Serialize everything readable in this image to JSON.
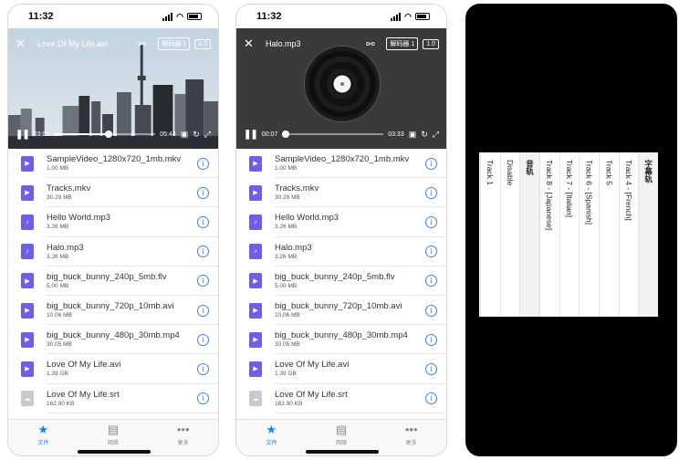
{
  "status": {
    "time": "11:32"
  },
  "screen1": {
    "player": {
      "title": "Love Of My Life.avi",
      "decoder_label": "解码器 1",
      "speed_label": "1.0",
      "current_time": "03:05",
      "total_time": "05:44",
      "progress": 0.54
    }
  },
  "screen2": {
    "player": {
      "title": "Halo.mp3",
      "decoder_label": "解码器 1",
      "speed_label": "1.0",
      "current_time": "00:07",
      "total_time": "03:33",
      "progress": 0.03
    }
  },
  "files": [
    {
      "name": "SampleVideo_1280x720_1mb.mkv",
      "size": "1.00 MB",
      "type": "video"
    },
    {
      "name": "Tracks.mkv",
      "size": "30.29 MB",
      "type": "video"
    },
    {
      "name": "Hello World.mp3",
      "size": "3.26 MB",
      "type": "audio"
    },
    {
      "name": "Halo.mp3",
      "size": "3.26 MB",
      "type": "audio"
    },
    {
      "name": "big_buck_bunny_240p_5mb.flv",
      "size": "5.00 MB",
      "type": "video"
    },
    {
      "name": "big_buck_bunny_720p_10mb.avi",
      "size": "10.06 MB",
      "type": "video"
    },
    {
      "name": "big_buck_bunny_480p_30mb.mp4",
      "size": "30.05 MB",
      "type": "video"
    },
    {
      "name": "Love Of My Life.avi",
      "size": "1.39 GB",
      "type": "video"
    },
    {
      "name": "Love Of My Life.srt",
      "size": "162.90 KB",
      "type": "subtitle"
    }
  ],
  "tabs": [
    {
      "label": "文件",
      "icon": "star-icon",
      "active": true
    },
    {
      "label": "网络",
      "icon": "network-icon",
      "active": false
    },
    {
      "label": "更多",
      "icon": "more-icon",
      "active": false
    }
  ],
  "track_sheet": {
    "subtitle_header": "字幕轨",
    "subtitle_tracks": [
      "Track 4 - [French]",
      "Track 5",
      "Track 6 - [Spanish]",
      "Track 7 - [Italian]",
      "Track 8 - [Japanese]"
    ],
    "audio_header": "音轨",
    "audio_tracks": [
      "Disable",
      "Track 1"
    ]
  },
  "colors": {
    "accent": "#1a82f0",
    "file_icon": "#6e60e6",
    "info": "#3b82e6"
  }
}
